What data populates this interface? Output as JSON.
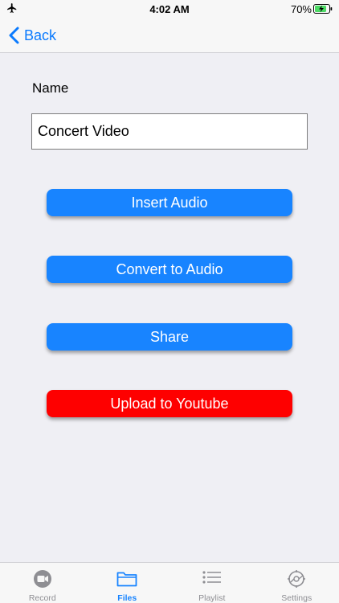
{
  "status_bar": {
    "time": "4:02 AM",
    "battery_percent": "70%",
    "airplane_icon": "airplane-icon",
    "battery_icon": "battery-charging-icon"
  },
  "nav": {
    "back_label": "Back",
    "back_icon": "chevron-left-icon"
  },
  "form": {
    "name_label": "Name",
    "name_value": "Concert Video"
  },
  "actions": {
    "insert_audio": "Insert Audio",
    "convert_to_audio": "Convert to Audio",
    "share": "Share",
    "upload_youtube": "Upload to Youtube"
  },
  "tabs": [
    {
      "label": "Record",
      "icon": "record-icon",
      "active": false
    },
    {
      "label": "Files",
      "icon": "folder-icon",
      "active": true
    },
    {
      "label": "Playlist",
      "icon": "list-icon",
      "active": false
    },
    {
      "label": "Settings",
      "icon": "gear-icon",
      "active": false
    }
  ],
  "colors": {
    "accent": "#1884ff",
    "danger": "#fe0000",
    "background": "#efeff4",
    "inactive_tab": "#8e8e93"
  }
}
